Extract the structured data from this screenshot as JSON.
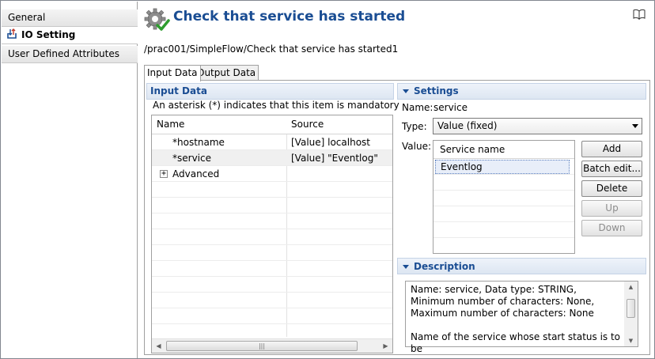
{
  "nav": {
    "items": [
      {
        "label": "General"
      },
      {
        "label": "IO Setting"
      },
      {
        "label": "User Defined Attributes"
      }
    ]
  },
  "header": {
    "title": "Check that service has started",
    "path": "/prac001/SimpleFlow/Check that service has started1"
  },
  "tabs": [
    {
      "label": "Input Data"
    },
    {
      "label": "Output Data"
    }
  ],
  "input_data": {
    "title": "Input Data",
    "hint": "An asterisk (*) indicates that this item is mandatory",
    "columns": {
      "name": "Name",
      "source": "Source"
    },
    "rows": [
      {
        "name": "*hostname",
        "source": "[Value] localhost"
      },
      {
        "name": "*service",
        "source": "[Value] \"Eventlog\""
      },
      {
        "name": "Advanced",
        "source": ""
      }
    ],
    "expand_glyph": "+"
  },
  "settings": {
    "title": "Settings",
    "name_label": "Name:",
    "name_value": "service",
    "type_label": "Type:",
    "type_value": "Value (fixed)",
    "value_label": "Value:",
    "value_column": "Service name",
    "values": [
      "Eventlog"
    ],
    "buttons": {
      "add": "Add",
      "batch_edit": "Batch edit...",
      "delete": "Delete",
      "up": "Up",
      "down": "Down"
    }
  },
  "description": {
    "title": "Description",
    "line1": "Name: service, Data type: STRING, Minimum number of characters: None, Maximum number of characters: None",
    "line2": "Name of the service whose start status is to be"
  },
  "colors": {
    "accent": "#1a4d93",
    "check": "#2e9d2e"
  }
}
